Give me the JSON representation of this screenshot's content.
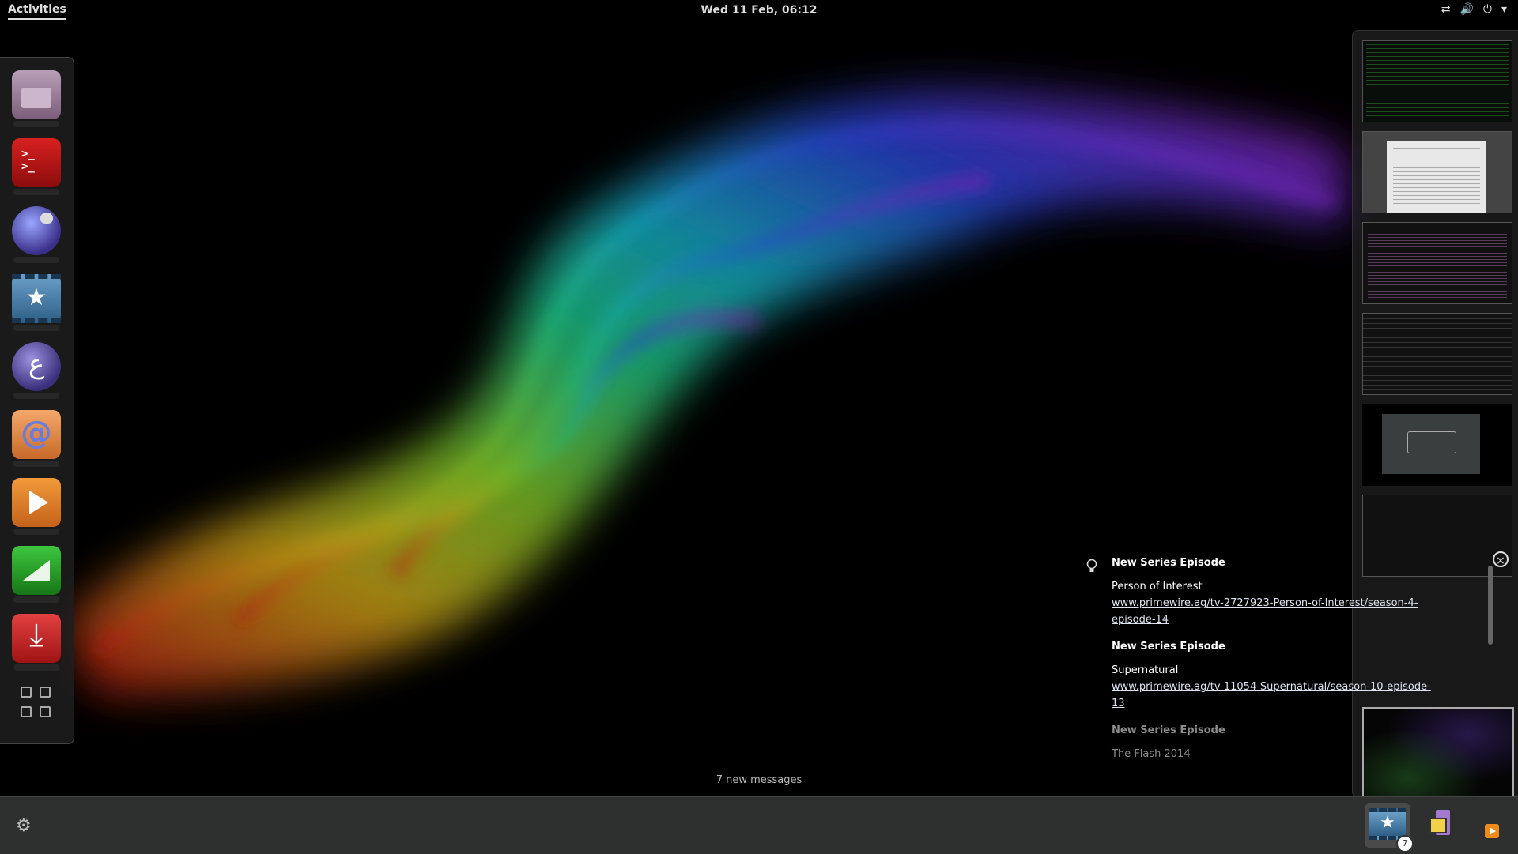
{
  "topbar": {
    "activities": "Activities",
    "clock": "Wed 11 Feb, 06:12",
    "icons": [
      "network-icon",
      "volume-icon",
      "power-icon",
      "dropdown-icon"
    ]
  },
  "dash": {
    "apps": [
      "files",
      "terminal",
      "web-browser",
      "media-center",
      "emacs",
      "blender",
      "media-player",
      "calculator",
      "downloader"
    ],
    "show_apps": "show-applications"
  },
  "notifications": [
    {
      "title": "New Series Episode",
      "show": "Person of Interest",
      "link": "www.primewire.ag/tv-2727923-Person-of-Interest/season-4-episode-14"
    },
    {
      "title": "New Series Episode",
      "show": "Supernatural",
      "link": "www.primewire.ag/tv-11054-Supernatural/season-10-episode-13"
    },
    {
      "title": "New Series Episode",
      "show": "The Flash 2014"
    }
  ],
  "new_messages": "7 new messages",
  "tray": {
    "badge_count": "7"
  }
}
